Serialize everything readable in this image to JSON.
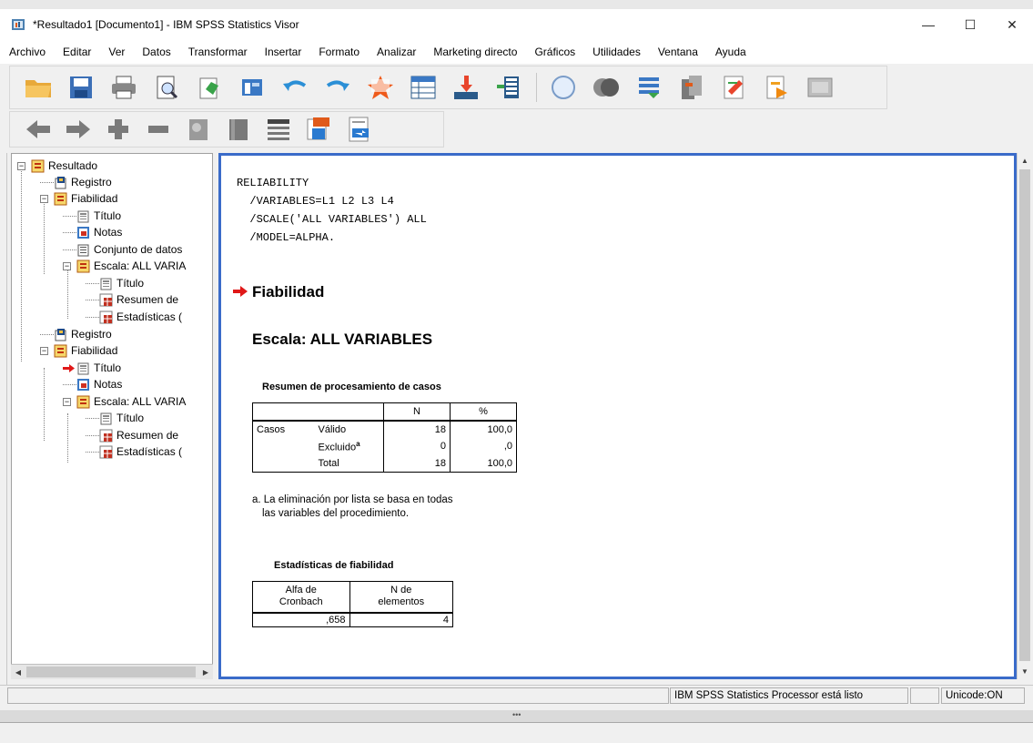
{
  "window": {
    "title": "*Resultado1 [Documento1] - IBM SPSS Statistics Visor",
    "controls": {
      "minimize": "—",
      "maximize": "☐",
      "close": "✕"
    }
  },
  "menubar": {
    "items": [
      "Archivo",
      "Editar",
      "Ver",
      "Datos",
      "Transformar",
      "Insertar",
      "Formato",
      "Analizar",
      "Marketing directo",
      "Gráficos",
      "Utilidades",
      "Ventana",
      "Ayuda"
    ]
  },
  "toolbar1": {
    "icons": [
      "open-folder-icon",
      "save-icon",
      "print-icon",
      "print-preview-icon",
      "export-icon",
      "recall-dialog-icon",
      "undo-icon",
      "redo-icon",
      "goto-data-icon",
      "goto-case-icon",
      "goto-variable-icon",
      "variables-icon",
      "show-all-icon",
      "hide-icon",
      "designate-window-icon",
      "create-title-icon",
      "insert-page-title-icon",
      "insert-text-icon",
      "run-script-icon"
    ]
  },
  "toolbar2": {
    "icons": [
      "promote-icon",
      "demote-icon",
      "expand-icon",
      "collapse-icon",
      "show-icon",
      "hide-icon",
      "insert-heading-icon",
      "insert-new-title-icon",
      "insert-text-icon"
    ]
  },
  "outline": {
    "items": [
      {
        "label": "Resultado",
        "icon": "output-book-icon"
      },
      {
        "label": "Registro",
        "icon": "log-icon"
      },
      {
        "label": "Fiabilidad",
        "icon": "output-book-icon"
      },
      {
        "label": "Título",
        "icon": "title-icon"
      },
      {
        "label": "Notas",
        "icon": "notes-icon"
      },
      {
        "label": "Conjunto de datos",
        "icon": "dataset-icon"
      },
      {
        "label": "Escala: ALL VARIA",
        "icon": "output-book-icon"
      },
      {
        "label": "Título",
        "icon": "title-icon"
      },
      {
        "label": "Resumen de",
        "icon": "table-icon"
      },
      {
        "label": "Estadísticas (",
        "icon": "table-icon"
      },
      {
        "label": "Registro",
        "icon": "log-icon"
      },
      {
        "label": "Fiabilidad",
        "icon": "output-book-icon"
      },
      {
        "label": "Título",
        "icon": "title-icon"
      },
      {
        "label": "Notas",
        "icon": "notes-icon"
      },
      {
        "label": "Escala: ALL VARIA",
        "icon": "output-book-icon"
      },
      {
        "label": "Título",
        "icon": "title-icon"
      },
      {
        "label": "Resumen de",
        "icon": "table-icon"
      },
      {
        "label": "Estadísticas (",
        "icon": "table-icon"
      }
    ]
  },
  "output": {
    "syntax": [
      "RELIABILITY",
      "  /VARIABLES=L1 L2 L3 L4",
      "  /SCALE('ALL VARIABLES') ALL",
      "  /MODEL=ALPHA."
    ],
    "heading": "Fiabilidad",
    "subheading": "Escala: ALL VARIABLES",
    "case_summary": {
      "title": "Resumen de procesamiento de casos",
      "col_n": "N",
      "col_pct": "%",
      "group": "Casos",
      "rows": [
        {
          "label": "Válido",
          "sup": "",
          "n": "18",
          "pct": "100,0"
        },
        {
          "label": "Excluido",
          "sup": "a",
          "n": "0",
          "pct": ",0"
        },
        {
          "label": "Total",
          "sup": "",
          "n": "18",
          "pct": "100,0"
        }
      ],
      "footnote_line1": "a. La eliminación por lista se basa en todas",
      "footnote_line2": "las variables del procedimiento."
    },
    "reliability": {
      "title": "Estadísticas de fiabilidad",
      "col1_line1": "Alfa de",
      "col1_line2": "Cronbach",
      "col2_line1": "N de",
      "col2_line2": "elementos",
      "alpha": ",658",
      "n_items": "4"
    }
  },
  "statusbar": {
    "processor": "IBM SPSS Statistics Processor está listo",
    "encoding": "Unicode:ON"
  }
}
